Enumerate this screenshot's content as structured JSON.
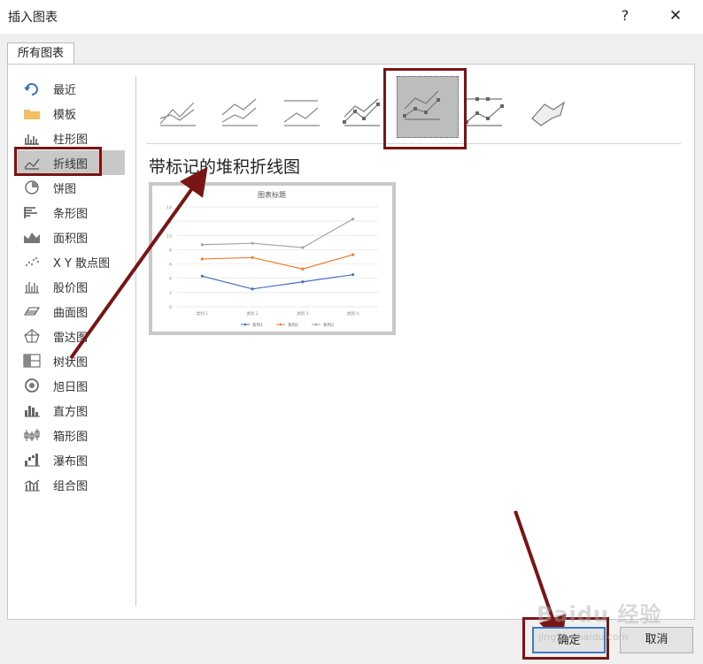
{
  "window": {
    "title": "插入图表",
    "help": "?",
    "close": "✕"
  },
  "tabs": [
    {
      "label": "所有图表"
    }
  ],
  "sidebar": {
    "items": [
      {
        "label": "最近",
        "icon": "undo-icon"
      },
      {
        "label": "模板",
        "icon": "folder-icon"
      },
      {
        "label": "柱形图",
        "icon": "column-chart-icon"
      },
      {
        "label": "折线图",
        "icon": "line-chart-icon",
        "selected": true
      },
      {
        "label": "饼图",
        "icon": "pie-chart-icon"
      },
      {
        "label": "条形图",
        "icon": "bar-chart-icon"
      },
      {
        "label": "面积图",
        "icon": "area-chart-icon"
      },
      {
        "label": "X Y 散点图",
        "icon": "scatter-chart-icon"
      },
      {
        "label": "股价图",
        "icon": "stock-chart-icon"
      },
      {
        "label": "曲面图",
        "icon": "surface-chart-icon"
      },
      {
        "label": "雷达图",
        "icon": "radar-chart-icon"
      },
      {
        "label": "树状图",
        "icon": "treemap-chart-icon"
      },
      {
        "label": "旭日图",
        "icon": "sunburst-chart-icon"
      },
      {
        "label": "直方图",
        "icon": "histogram-chart-icon"
      },
      {
        "label": "箱形图",
        "icon": "box-whisker-chart-icon"
      },
      {
        "label": "瀑布图",
        "icon": "waterfall-chart-icon"
      },
      {
        "label": "组合图",
        "icon": "combo-chart-icon"
      }
    ]
  },
  "subtypes": {
    "selected_index": 4,
    "items": [
      {
        "icon": "line-subtype-icon"
      },
      {
        "icon": "stacked-line-subtype-icon"
      },
      {
        "icon": "percent-stacked-line-subtype-icon"
      },
      {
        "icon": "line-with-markers-subtype-icon"
      },
      {
        "icon": "stacked-line-with-markers-subtype-icon"
      },
      {
        "icon": "percent-stacked-line-with-markers-subtype-icon"
      },
      {
        "icon": "3d-line-subtype-icon"
      }
    ]
  },
  "chart_name": "带标记的堆积折线图",
  "chart_data": {
    "type": "line",
    "title": "图表标题",
    "categories": [
      "类别 1",
      "类别 2",
      "类别 3",
      "类别 4"
    ],
    "ylim": [
      0,
      14
    ],
    "yticks": [
      "0",
      "2",
      "4",
      "6",
      "8",
      "10",
      "12",
      "14"
    ],
    "grid": true,
    "legend": "bottom",
    "series": [
      {
        "name": "系列1",
        "color": "#4472c4",
        "values": [
          4.3,
          2.5,
          3.5,
          4.5
        ]
      },
      {
        "name": "系列2",
        "color": "#ed7d31",
        "values": [
          6.7,
          6.9,
          5.3,
          7.3
        ]
      },
      {
        "name": "系列3",
        "color": "#a5a5a5",
        "values": [
          8.7,
          8.9,
          8.3,
          12.3
        ]
      }
    ]
  },
  "buttons": {
    "ok": "确定",
    "cancel": "取消"
  },
  "watermark": {
    "logo": "Baidu 经验",
    "url": "jingyan.baidu.com"
  },
  "colors": {
    "annotation": "#7a1515",
    "selected_bg": "#c8c8c8",
    "ok_border": "#3a7ac9"
  }
}
